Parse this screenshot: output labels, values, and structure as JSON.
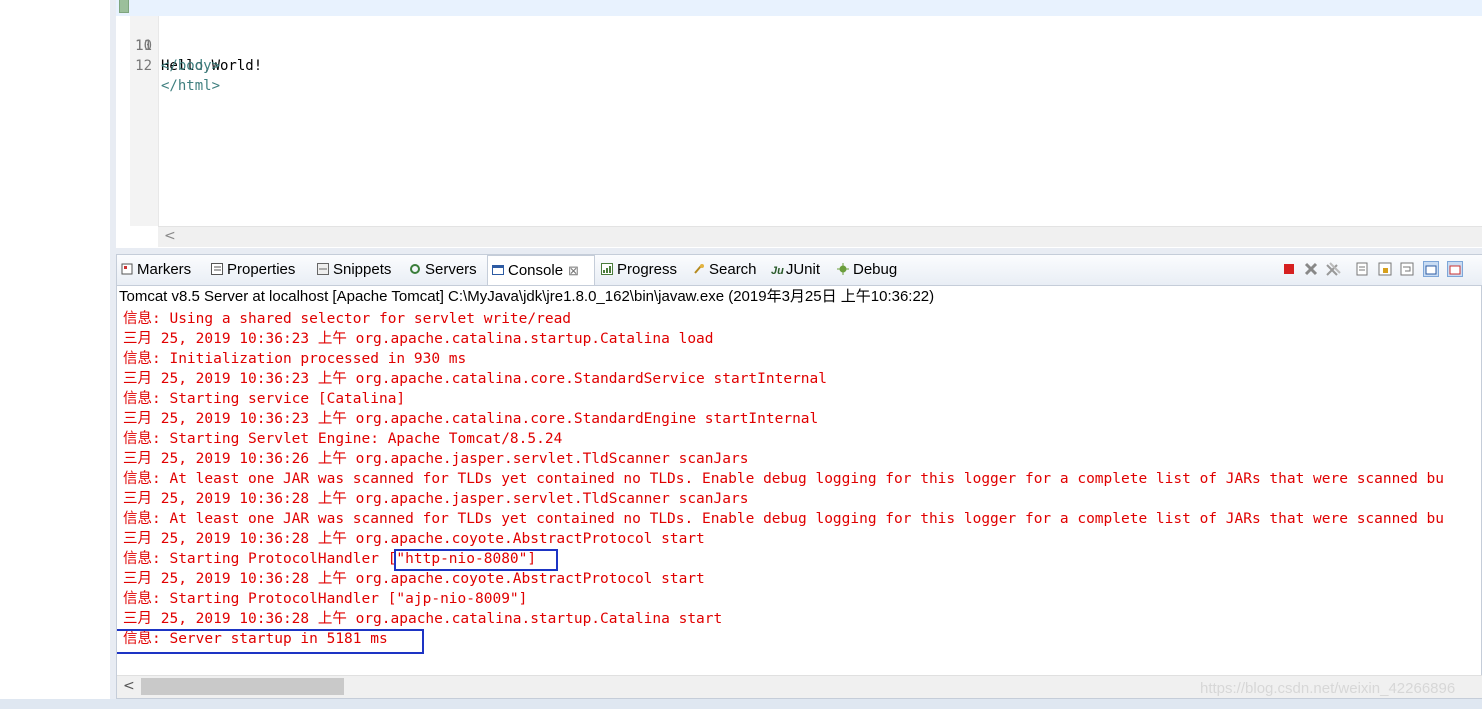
{
  "editor": {
    "lines": [
      {
        "num": "10",
        "text": "Hello,World!",
        "kind": "plain"
      },
      {
        "num": "11",
        "text": "</body>",
        "kind": "tag"
      },
      {
        "num": "12",
        "text": "</html>",
        "kind": "tag"
      }
    ],
    "scroll_left_glyph": "<"
  },
  "views": {
    "tabs": [
      {
        "label": "Markers",
        "icon": "markers-icon"
      },
      {
        "label": "Properties",
        "icon": "properties-icon"
      },
      {
        "label": "Snippets",
        "icon": "snippets-icon"
      },
      {
        "label": "Servers",
        "icon": "servers-icon"
      },
      {
        "label": "Console",
        "icon": "console-icon",
        "active": true,
        "close": "⊠"
      },
      {
        "label": "Progress",
        "icon": "progress-icon"
      },
      {
        "label": "Search",
        "icon": "search-icon"
      },
      {
        "label": "JUnit",
        "icon": "junit-icon",
        "icon_text": "Ju"
      },
      {
        "label": "Debug",
        "icon": "debug-icon"
      }
    ]
  },
  "console": {
    "process_label": "Tomcat v8.5 Server at localhost [Apache Tomcat] C:\\MyJava\\jdk\\jre1.8.0_162\\bin\\javaw.exe (2019年3月25日 上午10:36:22)",
    "lines": [
      "信息: Using a shared selector for servlet write/read",
      "三月 25, 2019 10:36:23 上午 org.apache.catalina.startup.Catalina load",
      "信息: Initialization processed in 930 ms",
      "三月 25, 2019 10:36:23 上午 org.apache.catalina.core.StandardService startInternal",
      "信息: Starting service [Catalina]",
      "三月 25, 2019 10:36:23 上午 org.apache.catalina.core.StandardEngine startInternal",
      "信息: Starting Servlet Engine: Apache Tomcat/8.5.24",
      "三月 25, 2019 10:36:26 上午 org.apache.jasper.servlet.TldScanner scanJars",
      "信息: At least one JAR was scanned for TLDs yet contained no TLDs. Enable debug logging for this logger for a complete list of JARs that were scanned bu",
      "三月 25, 2019 10:36:28 上午 org.apache.jasper.servlet.TldScanner scanJars",
      "信息: At least one JAR was scanned for TLDs yet contained no TLDs. Enable debug logging for this logger for a complete list of JARs that were scanned bu",
      "三月 25, 2019 10:36:28 上午 org.apache.coyote.AbstractProtocol start",
      "信息: Starting ProtocolHandler [\"http-nio-8080\"]",
      "三月 25, 2019 10:36:28 上午 org.apache.coyote.AbstractProtocol start",
      "信息: Starting ProtocolHandler [\"ajp-nio-8009\"]",
      "三月 25, 2019 10:36:28 上午 org.apache.catalina.startup.Catalina start",
      "信息: Server startup in 5181 ms"
    ],
    "text_color": "#e00000",
    "highlight_color": "#1d34c4",
    "scroll_left_glyph": "<"
  },
  "watermark": "https://blog.csdn.net/weixin_42266896"
}
